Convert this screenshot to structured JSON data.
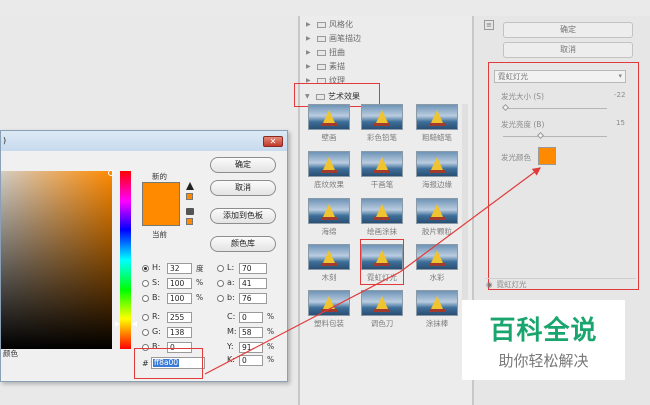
{
  "gallery": {
    "categories": [
      "风格化",
      "画笔描边",
      "扭曲",
      "素描",
      "纹理",
      "艺术效果"
    ],
    "thumbs": [
      "壁画",
      "彩色铅笔",
      "粗糙蜡笔",
      "底纹效果",
      "干画笔",
      "海报边缘",
      "海绵",
      "绘画涂抹",
      "胶片颗粒",
      "木刻",
      "霓虹灯光",
      "水彩",
      "塑料包装",
      "调色刀",
      "涂抹棒"
    ]
  },
  "right_panel": {
    "ok": "确定",
    "cancel": "取消",
    "filter": "霓虹灯光",
    "glow_size_label": "发光大小 (S)",
    "glow_size_value": "-22",
    "glow_brightness_label": "发光亮度 (B)",
    "glow_brightness_value": "15",
    "glow_color_label": "发光颜色",
    "effect_layer": "霓虹灯光",
    "glow_color": "#ff8a00"
  },
  "picker": {
    "title": ")",
    "new_label": "新的",
    "current_label": "当前",
    "ok": "确定",
    "cancel": "取消",
    "add_swatch": "添加到色板",
    "libraries": "颜色库",
    "h_label": "H:",
    "h_value": "32",
    "h_unit": "度",
    "s_label": "S:",
    "s_value": "100",
    "s_unit": "%",
    "b_label": "B:",
    "b_value": "100",
    "b_unit": "%",
    "r_label": "R:",
    "r_value": "255",
    "g_label": "G:",
    "g_value": "138",
    "bb_label": "B:",
    "bb_value": "0",
    "l_label": "L:",
    "l_value": "70",
    "a_label": "a:",
    "a_value": "41",
    "b2_label": "b:",
    "b2_value": "76",
    "c_label": "C:",
    "c_value": "0",
    "c_unit": "%",
    "m_label": "M:",
    "m_value": "58",
    "m_unit": "%",
    "y_label": "Y:",
    "y_value": "91",
    "y_unit": "%",
    "k_label": "K:",
    "k_value": "0",
    "k_unit": "%",
    "hash": "#",
    "hex": "ff8a00",
    "left_cut_label": "颜色",
    "color": "#ff8a00"
  },
  "watermark": {
    "line1": "百科全说",
    "line2": "助你轻松解决"
  }
}
